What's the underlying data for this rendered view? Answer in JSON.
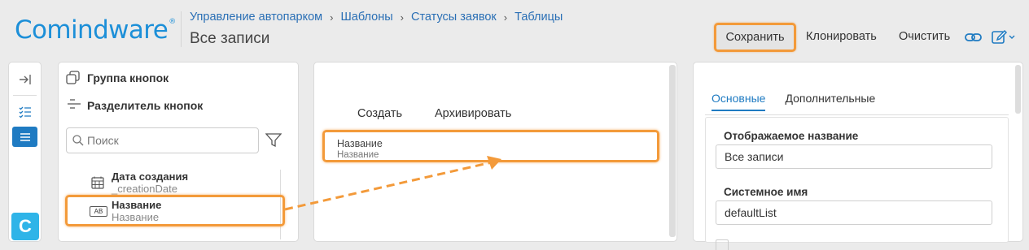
{
  "header": {
    "logo": "Comindware",
    "logo_mark": "®",
    "breadcrumbs": [
      "Управление автопарком",
      "Шаблоны",
      "Статусы заявок",
      "Таблицы"
    ],
    "title": "Все записи"
  },
  "toolbar": {
    "save_label": "Сохранить",
    "clone_label": "Клонировать",
    "clear_label": "Очистить"
  },
  "rail": {
    "logo_letter": "C"
  },
  "palette": {
    "button_group_label": "Группа кнопок",
    "button_separator_label": "Разделитель кнопок",
    "search": {
      "placeholder": "Поиск"
    },
    "fields": [
      {
        "name": "Дата создания",
        "system_name": "_creationDate"
      },
      {
        "name": "Название",
        "system_name": "Название",
        "type_badge": "AB"
      }
    ]
  },
  "designer": {
    "buttons": [
      "Создать",
      "Архивировать"
    ],
    "column": {
      "title": "Название",
      "subtitle": "Название"
    }
  },
  "properties": {
    "tabs": [
      "Основные",
      "Дополнительные"
    ],
    "active_tab": "Основные",
    "display_name_label": "Отображаемое название",
    "display_name_value": "Все записи",
    "system_name_label": "Системное имя",
    "system_name_value": "defaultList"
  },
  "colors": {
    "accent": "#1f7bc2",
    "highlight": "#f39a3a",
    "logo": "#1c8fd8"
  }
}
